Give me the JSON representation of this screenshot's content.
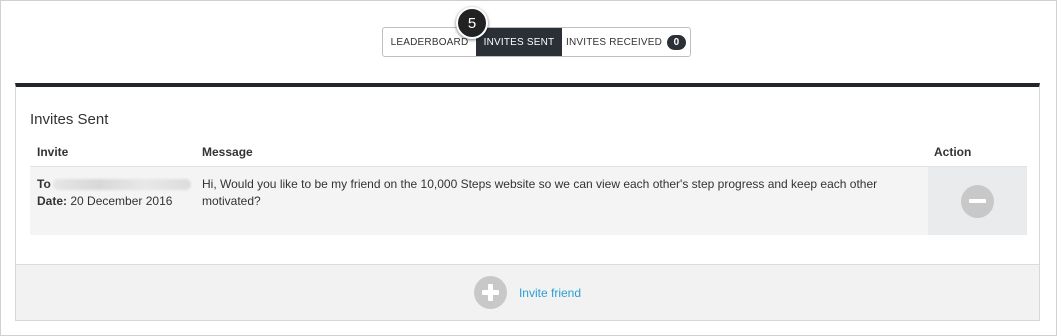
{
  "tabs": {
    "leaderboard": "LEADERBOARD",
    "invites_sent": "INVITES SENT",
    "invites_received": "INVITES RECEIVED",
    "received_count": "0"
  },
  "step_marker": "5",
  "panel": {
    "title": "Invites Sent",
    "columns": {
      "invite": "Invite",
      "message": "Message",
      "action": "Action"
    },
    "rows": [
      {
        "to_label": "To",
        "date_label": "Date:",
        "date_value": "20 December 2016",
        "message": "Hi, Would you like to be my friend on the 10,000 Steps website so we can view each other's step progress and keep each other motivated?"
      }
    ]
  },
  "footer": {
    "invite_friend": "Invite friend"
  },
  "colors": {
    "active_tab": "#2b2f36",
    "link": "#2a9fd6",
    "icon_gray": "#c8c8c8"
  },
  "icons": {
    "remove": "minus-circle-icon",
    "add": "plus-circle-icon"
  }
}
